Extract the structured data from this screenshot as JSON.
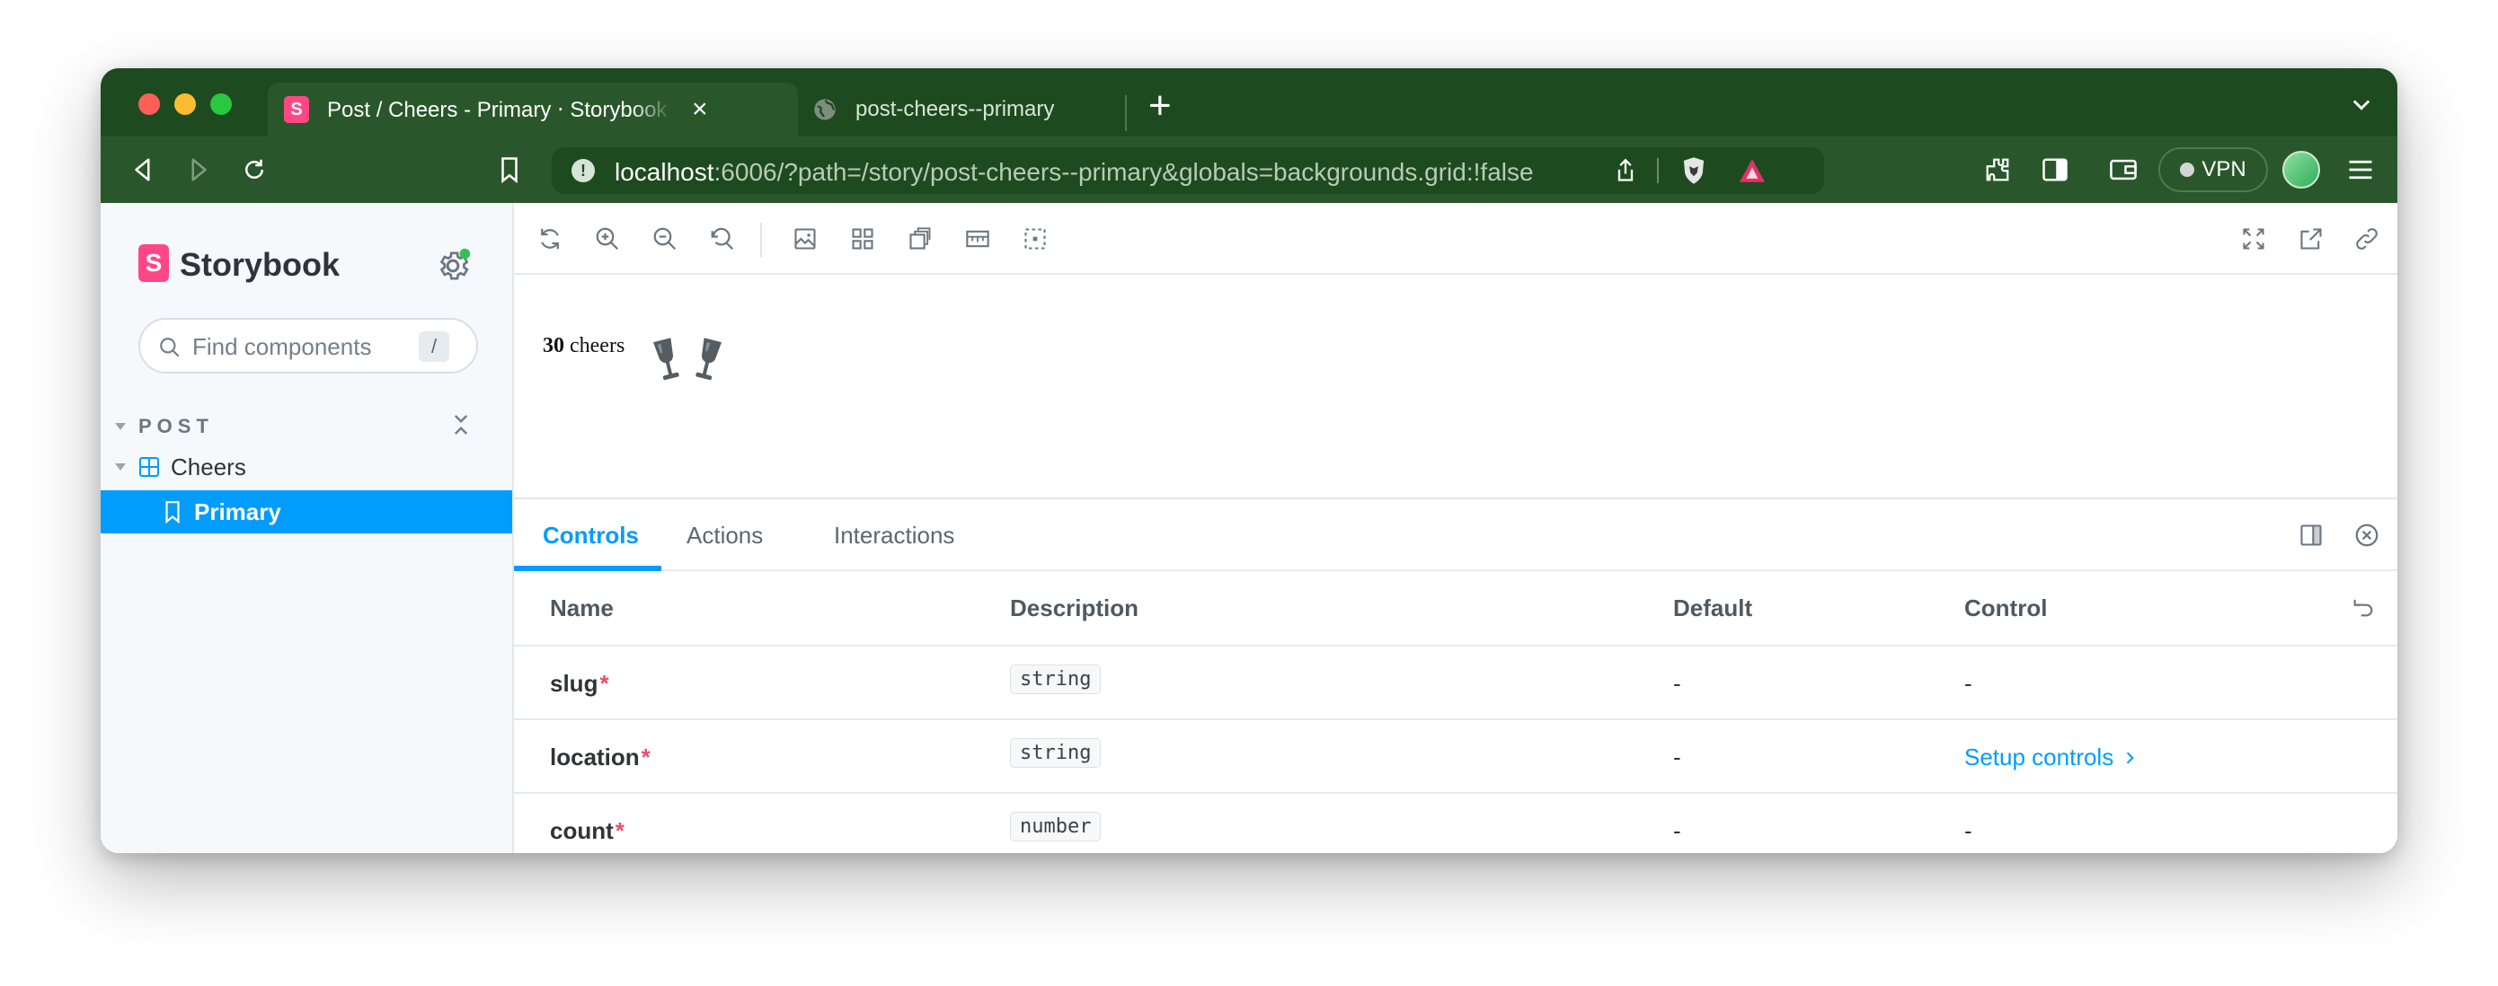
{
  "browser": {
    "tabs": [
      {
        "title": "Post / Cheers - Primary ⋅ Storybook",
        "favicon_letter": "S",
        "active": true
      },
      {
        "title": "post-cheers--primary",
        "active": false
      }
    ],
    "url_host": "localhost",
    "url_rest": ":6006/?path=/story/post-cheers--primary&globals=backgrounds.grid:!false",
    "vpn_label": "VPN"
  },
  "sidebar": {
    "logo_letter": "S",
    "brand": "Storybook",
    "search_placeholder": "Find components",
    "search_shortcut": "/",
    "group_label": "POST",
    "component": "Cheers",
    "story": "Primary"
  },
  "preview": {
    "count": "30",
    "label": "cheers",
    "icon": "clinking-glasses-icon"
  },
  "addons": {
    "tabs": [
      "Controls",
      "Actions",
      "Interactions"
    ],
    "active_tab": "Controls"
  },
  "controls_table": {
    "headers": {
      "name": "Name",
      "description": "Description",
      "default": "Default",
      "control": "Control"
    },
    "rows": [
      {
        "name": "slug",
        "required": "*",
        "type": "string",
        "default": "-",
        "control": "-"
      },
      {
        "name": "location",
        "required": "*",
        "type": "string",
        "default": "-",
        "control": "Setup controls"
      },
      {
        "name": "count",
        "required": "*",
        "type": "number",
        "default": "-",
        "control": "-"
      }
    ]
  },
  "colors": {
    "browser_chrome": "#1e4a20",
    "accent": "#029cfd",
    "storybook_pink": "#ff4785",
    "required": "#e84f6c"
  }
}
